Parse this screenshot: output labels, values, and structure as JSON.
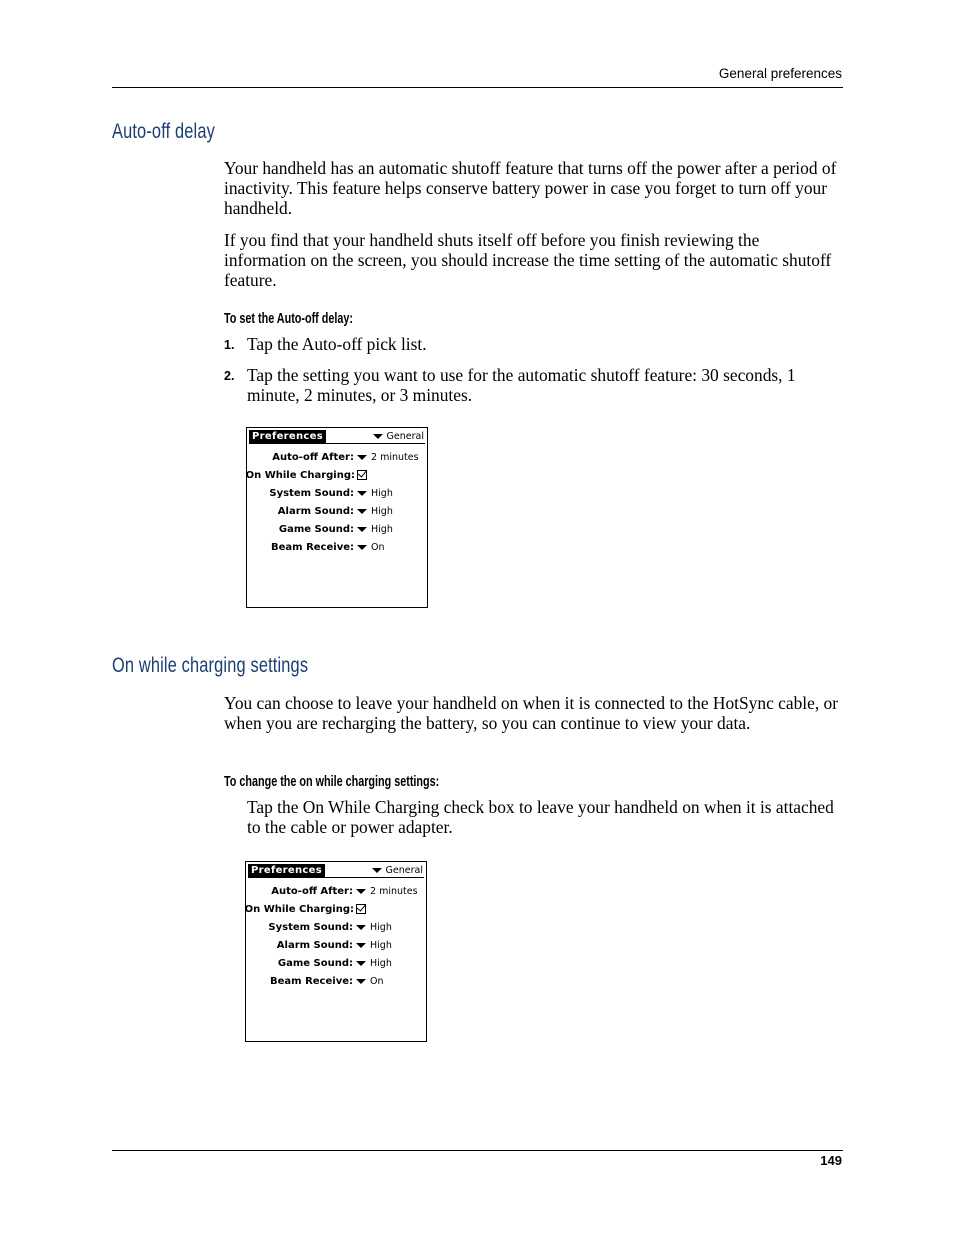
{
  "header": {
    "running_title": "General preferences"
  },
  "section1": {
    "heading": "Auto-off delay",
    "paragraphs": [
      "Your handheld has an automatic shutoff feature that turns off the power after a period of inactivity. This feature helps conserve battery power in case you forget to turn off your handheld.",
      "If you find that your handheld shuts itself off before you finish reviewing the information on the screen, you should increase the time setting of the automatic shutoff feature."
    ],
    "procedure_title": "To set the Auto-off delay:",
    "steps": [
      {
        "num": "1.",
        "text": "Tap the Auto-off pick list."
      },
      {
        "num": "2.",
        "text": "Tap the setting you want to use for the automatic shutoff feature: 30 seconds, 1 minute, 2 minutes, or 3 minutes."
      }
    ]
  },
  "section2": {
    "heading": "On while charging settings",
    "paragraphs": [
      "You can choose to leave your handheld on when it is connected to the HotSync cable, or when you are recharging the battery, so you can continue to view your data."
    ],
    "procedure_title": "To change the on while charging settings:",
    "instruction": "Tap the On While Charging check box to leave your handheld on when it is attached to the cable or power adapter."
  },
  "screen": {
    "title": "Preferences",
    "category": "General",
    "rows": [
      {
        "label": "Auto-off After:",
        "value": "2 minutes",
        "type": "picklist"
      },
      {
        "label": "On While Charging:",
        "value": "",
        "type": "checkbox",
        "checked": true
      },
      {
        "label": "System Sound:",
        "value": "High",
        "type": "picklist"
      },
      {
        "label": "Alarm Sound:",
        "value": "High",
        "type": "picklist"
      },
      {
        "label": "Game Sound:",
        "value": "High",
        "type": "picklist"
      },
      {
        "label": "Beam Receive:",
        "value": "On",
        "type": "picklist"
      }
    ]
  },
  "footer": {
    "page_number": "149"
  }
}
